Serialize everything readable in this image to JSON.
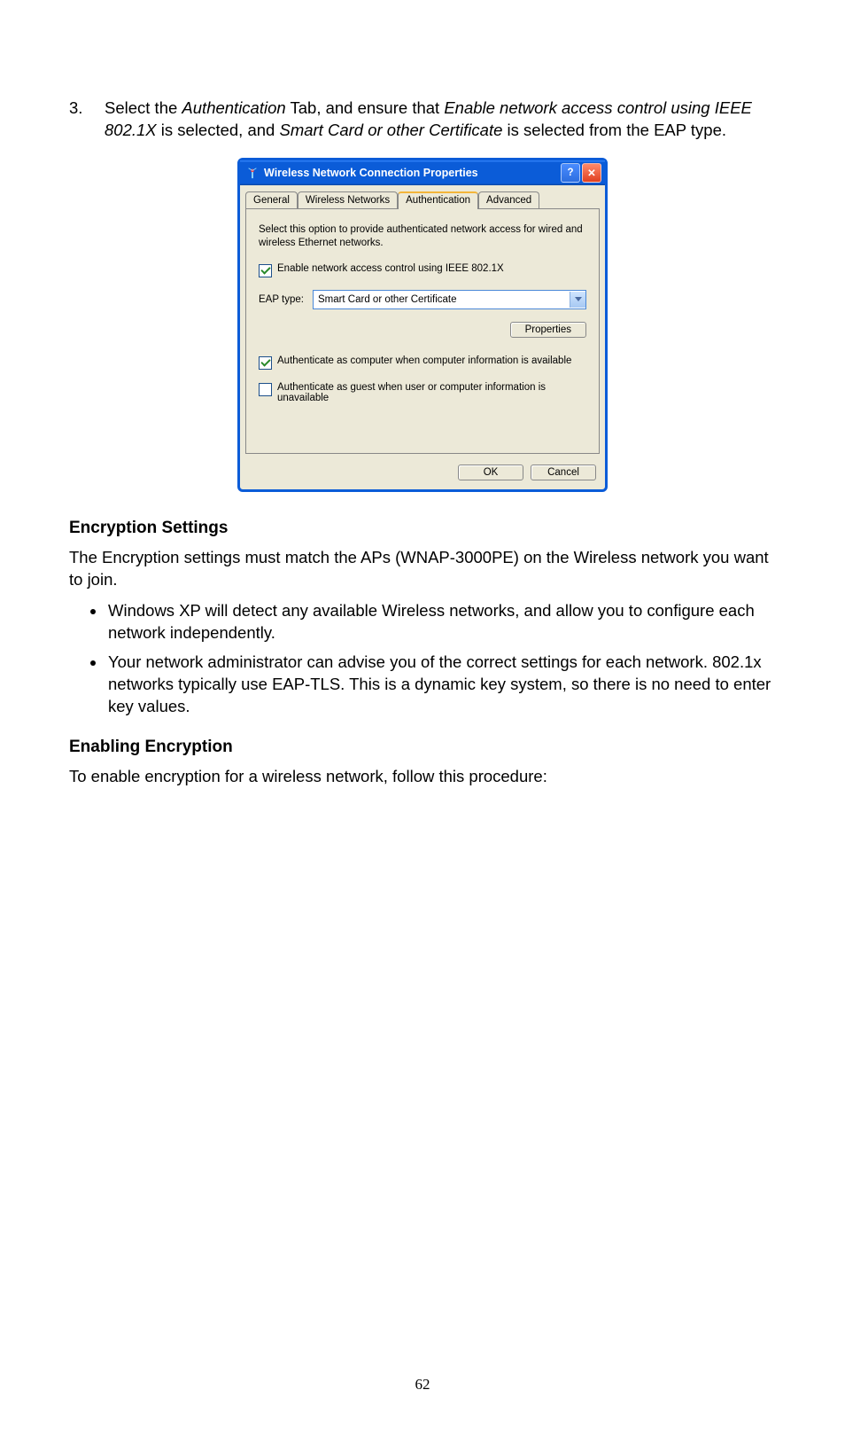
{
  "step": {
    "number": "3.",
    "text_pre": "Select the ",
    "tab_name": "Authentication",
    "text_mid1": " Tab, and ensure that ",
    "option1": "Enable network access control using IEEE 802.1X",
    "text_mid2": " is selected, and ",
    "option2": "Smart Card or other Certificate",
    "text_post": " is selected from the EAP type."
  },
  "dialog": {
    "title": "Wireless Network Connection Properties",
    "tabs": {
      "general": "General",
      "wireless": "Wireless Networks",
      "auth": "Authentication",
      "advanced": "Advanced"
    },
    "description": "Select this option to provide authenticated network access for wired and wireless Ethernet networks.",
    "enable_label": "Enable network access control using IEEE 802.1X",
    "eap_label": "EAP type:",
    "eap_value": "Smart Card or other Certificate",
    "properties_btn": "Properties",
    "auth_computer": "Authenticate as computer when computer information is available",
    "auth_guest": "Authenticate as guest when user or computer information is unavailable",
    "ok": "OK",
    "cancel": "Cancel"
  },
  "sections": {
    "encryption_heading": "Encryption Settings",
    "encryption_p": "The Encryption settings must match the APs (WNAP-3000PE) on the Wireless network you want to join.",
    "bullets": [
      "Windows XP will detect any available Wireless networks, and allow you to configure each network independently.",
      "Your network administrator can advise you of the correct settings for each network. 802.1x networks typically use EAP-TLS. This is a dynamic key system, so there is no need to enter key values."
    ],
    "enabling_heading": "Enabling Encryption",
    "enabling_p": "To enable encryption for a wireless network, follow this procedure:"
  },
  "page_number": "62"
}
